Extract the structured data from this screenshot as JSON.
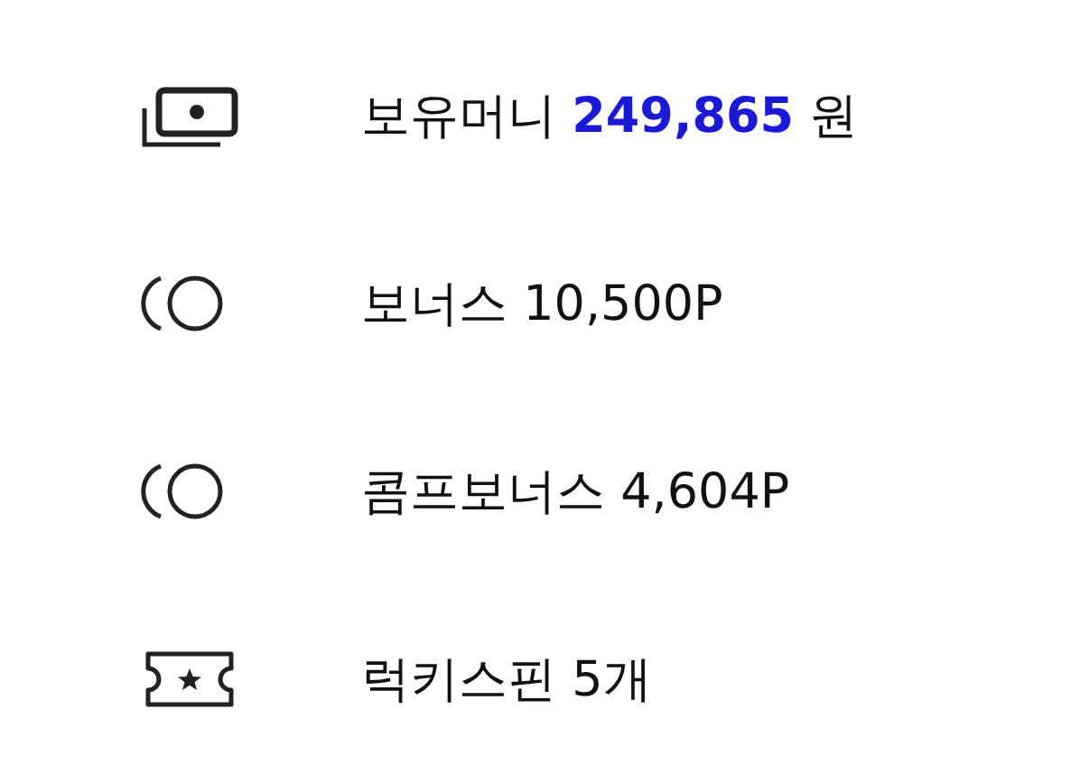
{
  "items": [
    {
      "kind": "money",
      "label": "보유머니",
      "amount": "249,865",
      "unit": "원"
    },
    {
      "kind": "coin",
      "label": "보너스 10,500P"
    },
    {
      "kind": "coin",
      "label": "콤프보너스 4,604P"
    },
    {
      "kind": "ticket",
      "label": "럭키스핀 5개"
    }
  ]
}
